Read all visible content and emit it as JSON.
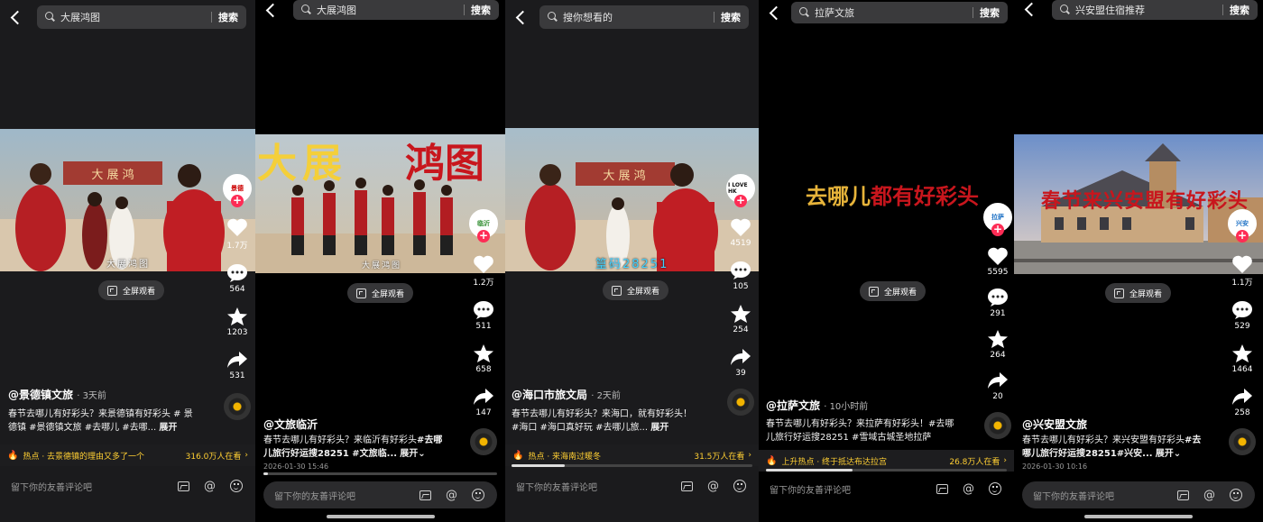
{
  "ui": {
    "fullscreen_label": "全屏观看",
    "search_label": "搜索",
    "expand_label": "展开",
    "comment_placeholder": "留下你的友善评论吧"
  },
  "colors": {
    "hot_text": "#ffcf33",
    "like": "#ffffff",
    "follow_plus": "#fe2c55",
    "progress": "#dddddd"
  },
  "panels": [
    {
      "query": "大展鸿图",
      "video_caption": "大展鸿图",
      "likes": "1.7万",
      "comments": "564",
      "favorites": "1203",
      "shares": "531",
      "author": "@景德镇文旅",
      "ago": "3天前",
      "desc": "春节去哪儿有好彩头？来景德镇有好彩头 # 景德镇 #景德镇文旅 #去哪儿 #去哪...",
      "hot_label": "热点 · 去景德镇的理由又多了一个",
      "hot_count": "316.0万人在看",
      "avatar_text": "景德"
    },
    {
      "query": "大展鸿图",
      "title_left": "大展",
      "title_right": "鸿图",
      "video_caption": "大展鸿图",
      "likes": "1.2万",
      "comments": "511",
      "favorites": "658",
      "shares": "147",
      "author": "@文旅临沂",
      "desc_plain": "春节去哪儿有好彩头？来临沂有好彩头",
      "desc_bold": "#去哪儿旅行好运搜28251 #文旅临...",
      "date": "2026-01-30 15:46",
      "avatar_text": "临沂",
      "progress": 0.02
    },
    {
      "query": "搜你想看的",
      "video_caption": "篁码28251",
      "likes": "4519",
      "comments": "105",
      "favorites": "254",
      "shares": "39",
      "author": "@海口市旅文局",
      "ago": "2天前",
      "desc": "春节去哪儿有好彩头？来海口，就有好彩头！#海口 #海口真好玩 #去哪儿旅...",
      "hot_label": "热点 · 来海南过暖冬",
      "hot_count": "31.5万人在看",
      "avatar_text": "I LOVE HK",
      "progress": 0.22
    },
    {
      "query": "拉萨文旅",
      "title_left": "去哪儿",
      "title_right": "都有好彩头",
      "likes": "5595",
      "comments": "291",
      "favorites": "264",
      "shares": "20",
      "author": "@拉萨文旅",
      "ago": "10小时前",
      "desc": "春节去哪儿有好彩头？来拉萨有好彩头！#去哪儿旅行好运搜28251 #雪域古城圣地拉萨",
      "hot_label": "上升热点 · 终于抵达布达拉宫",
      "hot_count": "26.8万人在看",
      "avatar_text": "拉萨",
      "progress": 0.36
    },
    {
      "query": "兴安盟住宿推荐",
      "title_overlay": "春节来兴安盟有好彩头",
      "likes": "1.1万",
      "comments": "529",
      "favorites": "1464",
      "shares": "258",
      "author": "@兴安盟文旅",
      "desc_plain": "春节去哪儿有好彩头？来兴安盟有好彩头",
      "desc_bold": "#去哪儿旅行好运搜28251#兴安...",
      "date": "2026-01-30 10:16",
      "avatar_text": "兴安"
    }
  ]
}
